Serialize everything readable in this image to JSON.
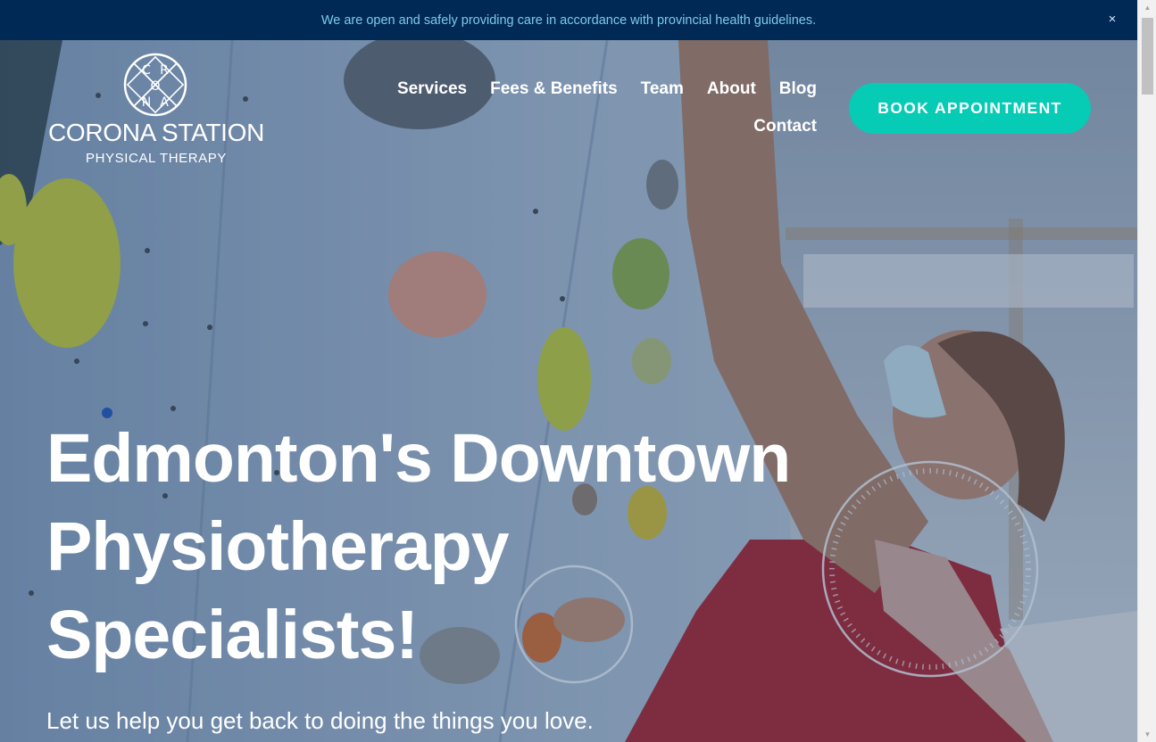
{
  "announcement": {
    "text": "We are open and safely providing care in accordance with provincial health guidelines.",
    "close_label": "×"
  },
  "logo": {
    "letters": [
      "C",
      "R",
      "O",
      "N",
      "A"
    ],
    "name": "CORONA STATION",
    "subtitle": "PHYSICAL THERAPY"
  },
  "nav": {
    "items": [
      {
        "label": "Services"
      },
      {
        "label": "Fees & Benefits"
      },
      {
        "label": "Team"
      },
      {
        "label": "About"
      },
      {
        "label": "Blog"
      },
      {
        "label": "Contact"
      }
    ]
  },
  "cta": {
    "label": "BOOK APPOINTMENT",
    "color": "#06cbb5"
  },
  "hero": {
    "headline_lines": [
      "Edmonton's Downtown",
      "Physiotherapy",
      "Specialists!"
    ],
    "subheadline": "Let us help you get back to doing the things you love."
  },
  "colors": {
    "announcement_bg": "#002a55",
    "announcement_text": "#7ec9e8",
    "accent": "#06cbb5"
  }
}
